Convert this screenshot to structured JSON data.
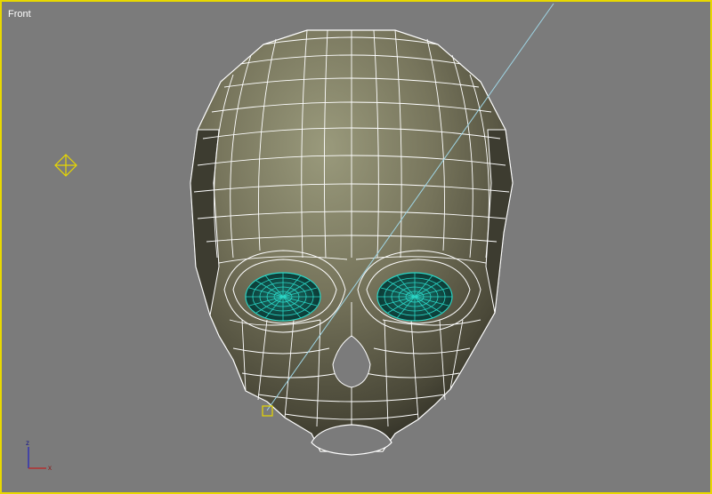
{
  "viewport": {
    "label": "Front",
    "active_border_color": "#e8d800",
    "background_color": "#7b7b7b"
  },
  "axis_gizmo": {
    "x_label": "x",
    "z_label": "z",
    "x_color": "#c02020",
    "z_color": "#2020c0"
  },
  "light_helper_icon": "light-target-icon",
  "camera_line_color": "#9fd6e6",
  "eye_selection_color": "#2ad4c4"
}
